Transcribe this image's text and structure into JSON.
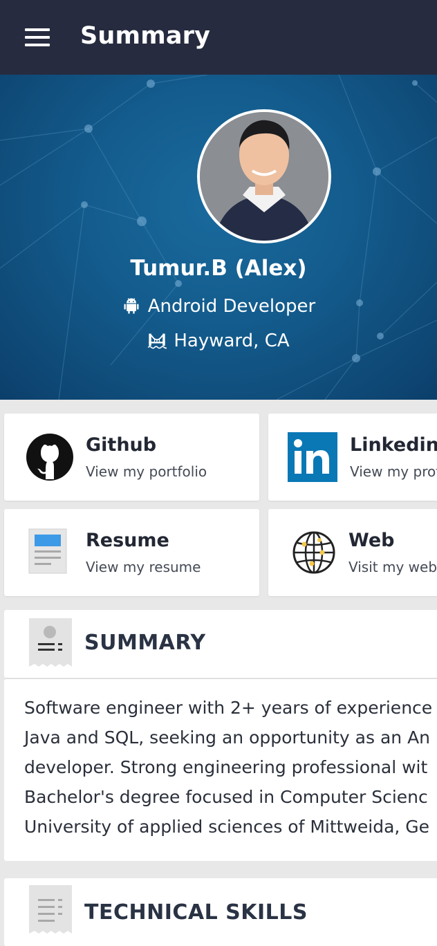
{
  "app_bar": {
    "title": "Summary",
    "menu_icon": "hamburger-menu-icon"
  },
  "profile": {
    "name": "Tumur.B (Alex)",
    "role": "Android Developer",
    "role_icon": "android-icon",
    "location": "Hayward, CA",
    "location_icon": "bridge-icon",
    "avatar": "profile-photo"
  },
  "links": [
    {
      "title": "Github",
      "subtitle": "View my portfolio",
      "icon": "github-icon"
    },
    {
      "title": "Linkedin",
      "subtitle": "View my profi",
      "icon": "linkedin-icon"
    },
    {
      "title": "Resume",
      "subtitle": "View my resume",
      "icon": "document-icon"
    },
    {
      "title": "Web",
      "subtitle": "Visit my webs",
      "icon": "globe-icon"
    }
  ],
  "sections": {
    "summary": {
      "title": "SUMMARY",
      "icon": "id-badge-icon",
      "lines": [
        "Software engineer with 2+ years of experience",
        "Java and SQL, seeking an opportunity as an An",
        "developer. Strong engineering professional wit",
        "Bachelor's degree focused in Computer Scienc",
        "University of applied sciences of Mittweida, Ge"
      ]
    },
    "technical_skills": {
      "title": "TECHNICAL SKILLS",
      "icon": "list-document-icon"
    }
  },
  "colors": {
    "app_bar": "#262b3f",
    "hero": "#135b8c",
    "card": "#ffffff",
    "background": "#e8e8e8",
    "linkedin_blue": "#0a78b5"
  }
}
